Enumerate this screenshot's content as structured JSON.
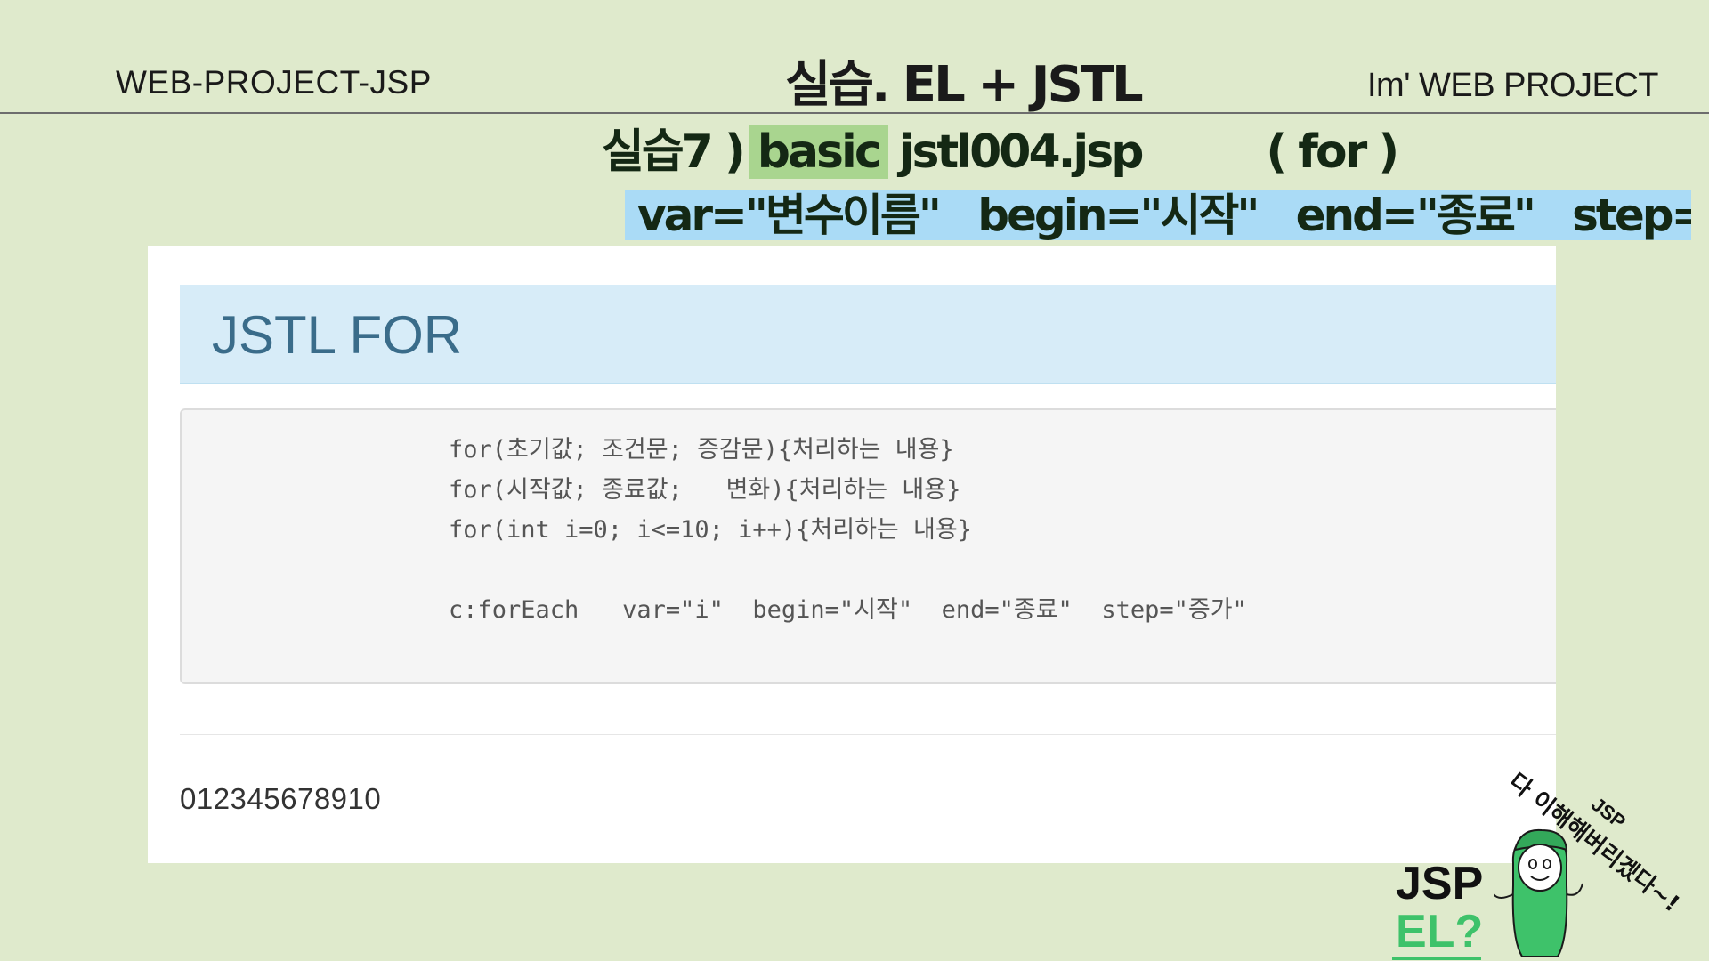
{
  "header": {
    "left": "WEB-PROJECT-JSP",
    "title": "실습. EL + JSTL",
    "right": "Im'  WEB PROJECT"
  },
  "subtitle": {
    "prefix": "실습7 )",
    "chip": "basic",
    "file": "jstl004.jsp",
    "tag": "( for )"
  },
  "syntax_bar": "var=\"변수이름\"   begin=\"시작\"   end=\"종료\"   step=\"증가\"",
  "screenshot": {
    "jumbotron_title": "JSTL FOR",
    "code_lines": [
      "for(초기값; 조건문; 증감문){처리하는 내용}",
      "for(시작값; 종료값;   변화){처리하는 내용}",
      "for(int i=0; i<=10; i++){처리하는 내용}"
    ],
    "code_foreach": "c:forEach   var=\"i\"  begin=\"시작\"  end=\"종료\"  step=\"증가\"",
    "output": "012345678910"
  },
  "mascot": {
    "speech": "다 이해해버리겠다~!",
    "tag": "JSP",
    "label_jsp": "JSP",
    "label_el": "EL?",
    "icon": "mascot-character-icon",
    "accent_color": "#3ec26a"
  }
}
